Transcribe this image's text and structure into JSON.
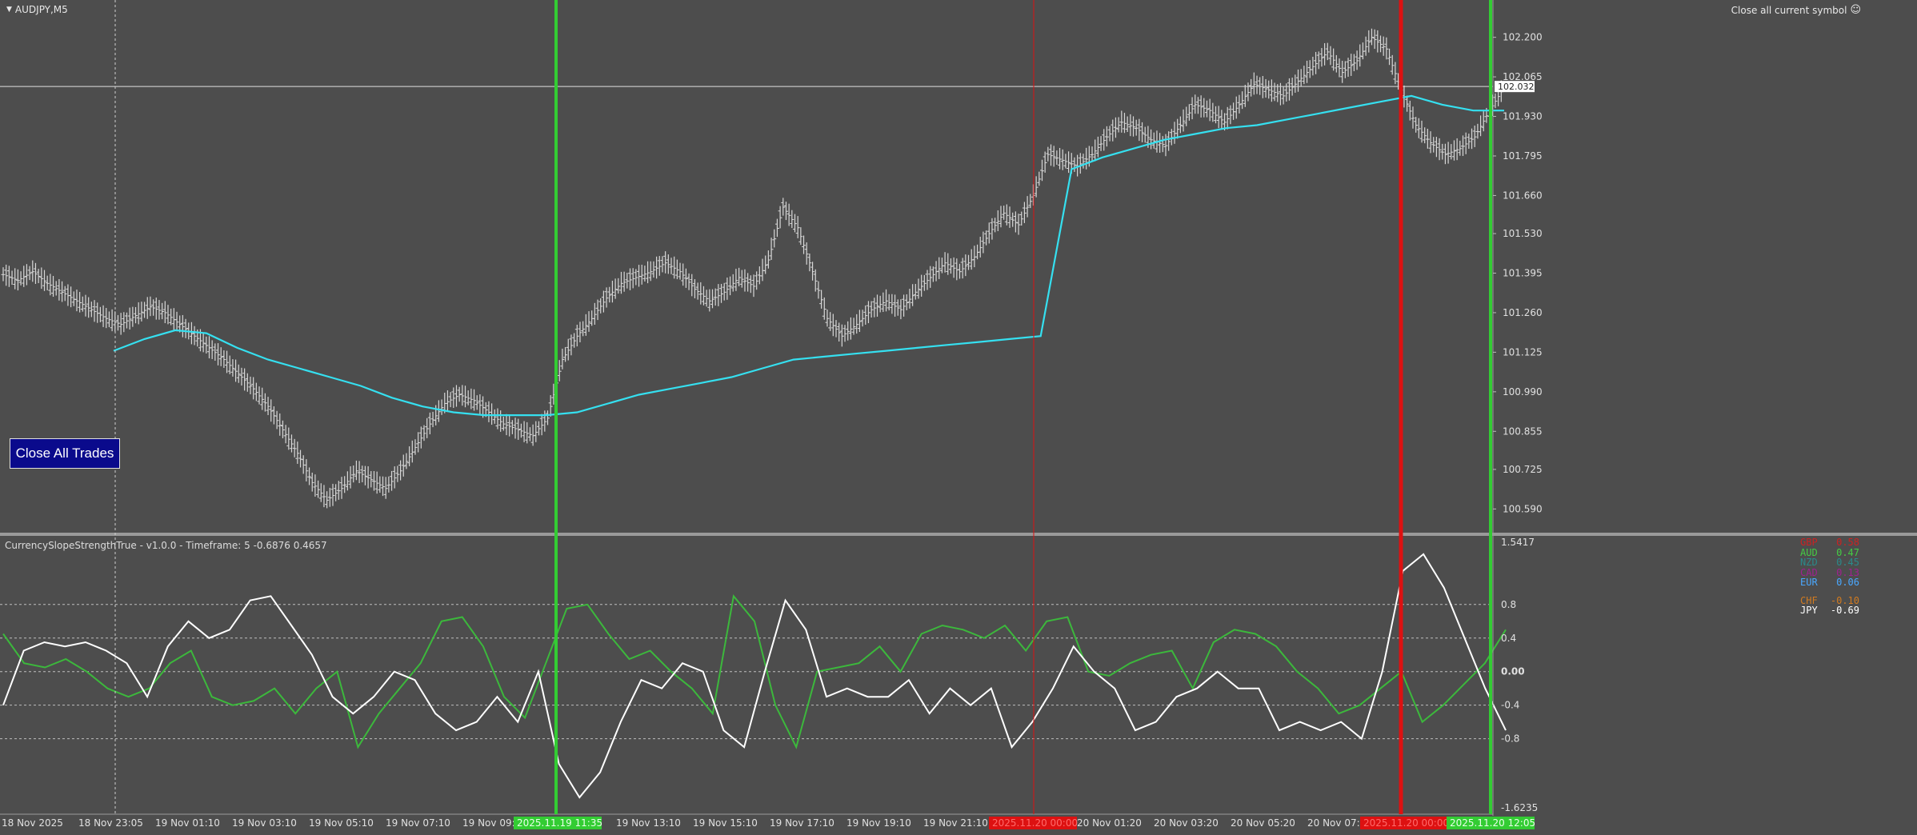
{
  "chart_header": {
    "symbol": "AUDJPY,M5",
    "close_symbol_label": "Close all current symbol"
  },
  "close_all_button": {
    "label": "Close All Trades"
  },
  "indicator": {
    "title": "CurrencySlopeStrengthTrue  -  v1.0.0  -  Timeframe: 5    -0.6876 0.4657",
    "legend": [
      {
        "currency": "GBP",
        "value": "0.58",
        "color": "#cc2222"
      },
      {
        "currency": "AUD",
        "value": "0.47",
        "color": "#44cc44"
      },
      {
        "currency": "NZD",
        "value": "0.45",
        "color": "#2a8a8a"
      },
      {
        "currency": "CAD",
        "value": "0.13",
        "color": "#a02090"
      },
      {
        "currency": "EUR",
        "value": "0.06",
        "color": "#4aa8ff"
      },
      {
        "currency": "CHF",
        "value": "-0.10",
        "color": "#d07a20"
      },
      {
        "currency": "JPY",
        "value": "-0.69",
        "color": "#ffffff"
      }
    ]
  },
  "colors": {
    "background": "#4d4d4d",
    "candle": "#d8d8d8",
    "ma": "#35e0f0",
    "aud_line": "#3cb83c",
    "jpy_line": "#ffffff",
    "green_marker": "#33cc33",
    "red_marker": "#dd1111",
    "price_line": "#e0e0e0"
  },
  "chart_data": [
    {
      "type": "line",
      "title": "AUDJPY,M5",
      "ylim": [
        100.52,
        102.3
      ],
      "y_ticks": [
        "102.200",
        "102.065",
        "101.930",
        "101.795",
        "101.660",
        "101.530",
        "101.395",
        "101.260",
        "101.125",
        "100.990",
        "100.855",
        "100.725",
        "100.590"
      ],
      "current_price": "102.032",
      "x_ticks": [
        "18 Nov 2025",
        "18 Nov 23:05",
        "19 Nov 01:10",
        "19 Nov 03:10",
        "19 Nov 05:10",
        "19 Nov 07:10",
        "19 Nov 09:",
        "19 Nov 13:10",
        "19 Nov 15:10",
        "19 Nov 17:10",
        "19 Nov 19:10",
        "19 Nov 21:10",
        "20 Nov 01:20",
        "20 Nov 03:20",
        "20 Nov 05:20",
        "20 Nov 07:"
      ],
      "x_highlight_labels": [
        {
          "label": "2025.11.19 11:35",
          "color": "#33cc33"
        },
        {
          "label": "2025.11.20 00:00",
          "color": "#dd1111"
        },
        {
          "label": "2025.11.20 00:00",
          "color": "#dd1111"
        },
        {
          "label": "2025.11.20 12:05",
          "color": "#33cc33"
        }
      ],
      "series": [
        {
          "name": "",
          "values": [
            101.39,
            101.37,
            101.4,
            101.36,
            101.33,
            101.3,
            101.27,
            101.24,
            101.22,
            101.25,
            101.28,
            101.26,
            101.22,
            101.18,
            101.14,
            101.1,
            101.05,
            101.0,
            100.94,
            100.86,
            100.78,
            100.68,
            100.62,
            100.66,
            100.72,
            100.69,
            100.66,
            100.72,
            100.8,
            100.88,
            100.95,
            100.98,
            100.96,
            100.92,
            100.88,
            100.86,
            100.84,
            100.9,
            101.1,
            101.18,
            101.24,
            101.31,
            101.36,
            101.38,
            101.4,
            101.43,
            101.4,
            101.34,
            101.3,
            101.33,
            101.38,
            101.35,
            101.44,
            101.62,
            101.55,
            101.4,
            101.24,
            101.18,
            101.22,
            101.27,
            101.3,
            101.27,
            101.33,
            101.38,
            101.43,
            101.4,
            101.45,
            101.53,
            101.6,
            101.56,
            101.66,
            101.8,
            101.78,
            101.76,
            101.8,
            101.86,
            101.91,
            101.89,
            101.85,
            101.83,
            101.9,
            101.97,
            101.95,
            101.91,
            101.97,
            102.04,
            102.02,
            102.0,
            102.05,
            102.1,
            102.15,
            102.08,
            102.12,
            102.2,
            102.16,
            102.02,
            101.9,
            101.84,
            101.8,
            101.82,
            101.86,
            101.95,
            102.03
          ]
        },
        {
          "name": "",
          "values": [
            101.13,
            101.17,
            101.2,
            101.19,
            101.14,
            101.1,
            101.07,
            101.04,
            101.01,
            100.97,
            100.94,
            100.92,
            100.91,
            100.91,
            100.91,
            100.92,
            100.95,
            100.98,
            101.0,
            101.02,
            101.04,
            101.07,
            101.1,
            101.11,
            101.12,
            101.13,
            101.14,
            101.15,
            101.16,
            101.17,
            101.18,
            101.75,
            101.79,
            101.82,
            101.85,
            101.87,
            101.89,
            101.9,
            101.92,
            101.94,
            101.96,
            101.98,
            102.0,
            101.97,
            101.95,
            101.95
          ]
        }
      ]
    },
    {
      "type": "line",
      "title": "CurrencySlopeStrengthTrue",
      "ylim": [
        -1.6235,
        1.5417
      ],
      "y_ticks": [
        "1.5417",
        "0.8",
        "0.4",
        "0.00",
        "-0.4",
        "-0.8",
        "-1.6235"
      ],
      "series": [
        {
          "name": "AUD",
          "values": [
            0.45,
            0.1,
            0.05,
            0.15,
            0.0,
            -0.2,
            -0.3,
            -0.2,
            0.1,
            0.25,
            -0.3,
            -0.4,
            -0.35,
            -0.2,
            -0.5,
            -0.2,
            0.0,
            -0.9,
            -0.5,
            -0.2,
            0.1,
            0.6,
            0.65,
            0.3,
            -0.3,
            -0.55,
            0.1,
            0.75,
            0.8,
            0.45,
            0.15,
            0.25,
            0.0,
            -0.2,
            -0.5,
            0.9,
            0.6,
            -0.4,
            -0.9,
            0.0,
            0.05,
            0.1,
            0.3,
            0.0,
            0.45,
            0.55,
            0.5,
            0.4,
            0.55,
            0.25,
            0.6,
            0.65,
            0.0,
            -0.05,
            0.1,
            0.2,
            0.25,
            -0.2,
            0.35,
            0.5,
            0.45,
            0.3,
            0.0,
            -0.2,
            -0.5,
            -0.4,
            -0.2,
            0.0,
            -0.6,
            -0.4,
            -0.15,
            0.1,
            0.5
          ]
        },
        {
          "name": "JPY",
          "values": [
            -0.4,
            0.25,
            0.35,
            0.3,
            0.35,
            0.25,
            0.1,
            -0.3,
            0.3,
            0.6,
            0.4,
            0.5,
            0.85,
            0.9,
            0.55,
            0.2,
            -0.3,
            -0.5,
            -0.3,
            0.0,
            -0.1,
            -0.5,
            -0.7,
            -0.6,
            -0.3,
            -0.6,
            0.0,
            -1.1,
            -1.5,
            -1.2,
            -0.6,
            -0.1,
            -0.2,
            0.1,
            0.0,
            -0.7,
            -0.9,
            0.0,
            0.85,
            0.5,
            -0.3,
            -0.2,
            -0.3,
            -0.3,
            -0.1,
            -0.5,
            -0.2,
            -0.4,
            -0.2,
            -0.9,
            -0.6,
            -0.2,
            0.3,
            0.0,
            -0.2,
            -0.7,
            -0.6,
            -0.3,
            -0.2,
            0.0,
            -0.2,
            -0.2,
            -0.7,
            -0.6,
            -0.7,
            -0.6,
            -0.8,
            0.0,
            1.2,
            1.4,
            1.0,
            0.4,
            -0.2,
            -0.7
          ]
        }
      ]
    }
  ]
}
